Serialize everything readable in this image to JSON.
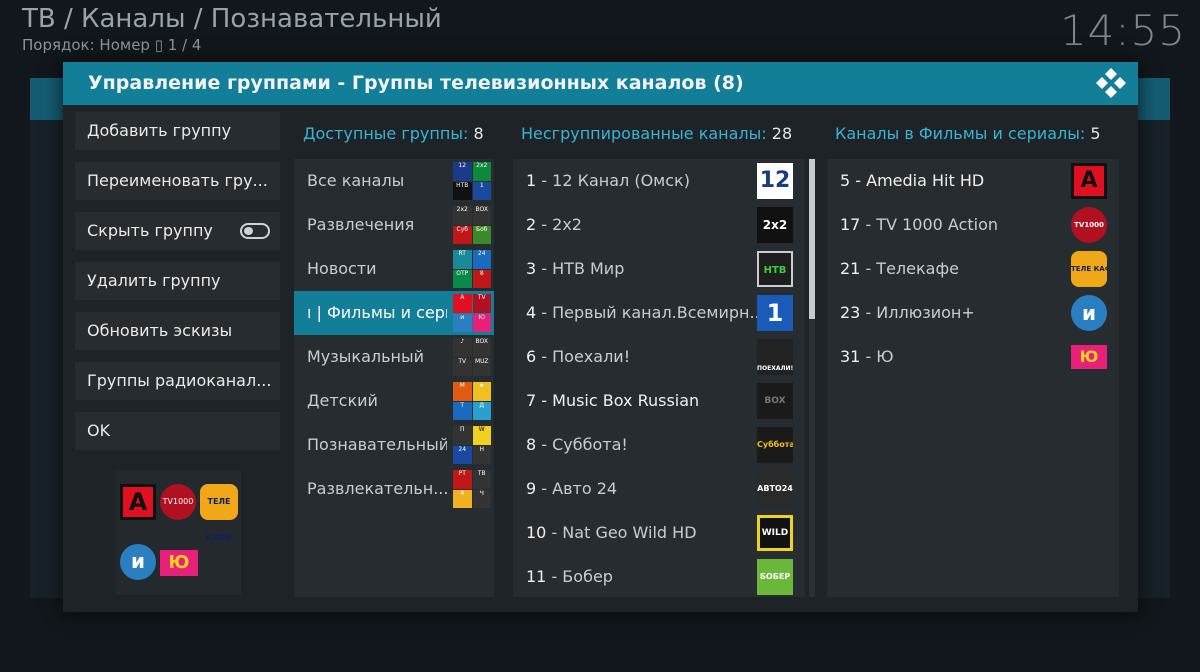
{
  "background": {
    "breadcrumb": "ТВ / Каналы / Познавательный",
    "sort_line": "Порядок: Номер  ▯  1 / 4",
    "clock": "14:55"
  },
  "dialog": {
    "title": "Управление группами - Группы телевизионных каналов (8)",
    "icon": "kodi-logo-icon",
    "buttons": {
      "add_group": "Добавить группу",
      "rename_group": "Переименовать гру...",
      "hide_group": "Скрыть группу",
      "delete_group": "Удалить группу",
      "refresh_thumbs": "Обновить эскизы",
      "radio_groups": "Группы радиоканал...",
      "ok": "OK"
    },
    "hide_group_toggle": false,
    "available": {
      "header_label": "Доступные группы:",
      "header_count": "8",
      "items": [
        "Все каналы",
        "Развлечения",
        "Новости",
        "ı | Фильмы и сериалы",
        "Музыкальный",
        "Детский",
        "Познавательный",
        "Развлекательн..."
      ],
      "selected_index": 3
    },
    "ungrouped": {
      "header_label": "Несгруппированные каналы:",
      "header_count": "28",
      "items": [
        {
          "num": "1",
          "name": " - 12 Канал (Омск)",
          "logo": "12"
        },
        {
          "num": "2",
          "name": " - 2x2",
          "logo": "2x2"
        },
        {
          "num": "3",
          "name": " - НТВ Мир",
          "logo": "НТВ"
        },
        {
          "num": "4",
          "name": " - Первый канал.Всемирн...",
          "logo": "1"
        },
        {
          "num": "6",
          "name": " - Поехали!",
          "logo": "ПОЕХАЛИ!"
        },
        {
          "num": "7",
          "name": " - Music Box Russian",
          "logo": "BOX"
        },
        {
          "num": "8",
          "name": " - Суббота!",
          "logo": "Суббота!"
        },
        {
          "num": "9",
          "name": " - Авто 24",
          "logo": "АВТО24"
        },
        {
          "num": "10",
          "name": " - Nat Geo Wild HD",
          "logo": "WILD"
        },
        {
          "num": "11",
          "name": " - Бобер",
          "logo": "БОБЕР"
        }
      ],
      "scroll_position": 0.0
    },
    "in_group": {
      "header_label": "Каналы в Фильмы и сериалы:",
      "header_count": "5",
      "items": [
        {
          "num": "5",
          "name": " - Amedia Hit HD",
          "logo": "A"
        },
        {
          "num": "17",
          "name": " - TV 1000 Action",
          "logo": "TV1000"
        },
        {
          "num": "21",
          "name": " - Телекафе",
          "logo": "ТЕЛЕ КАФЕ"
        },
        {
          "num": "23",
          "name": " - Иллюзион+",
          "logo": "и"
        },
        {
          "num": "31",
          "name": " - Ю",
          "logo": "Ю"
        }
      ]
    },
    "group_thumbs": [
      "A",
      "TV1000",
      "ТЕЛЕ КАФЕ",
      "и",
      "Ю"
    ]
  }
}
